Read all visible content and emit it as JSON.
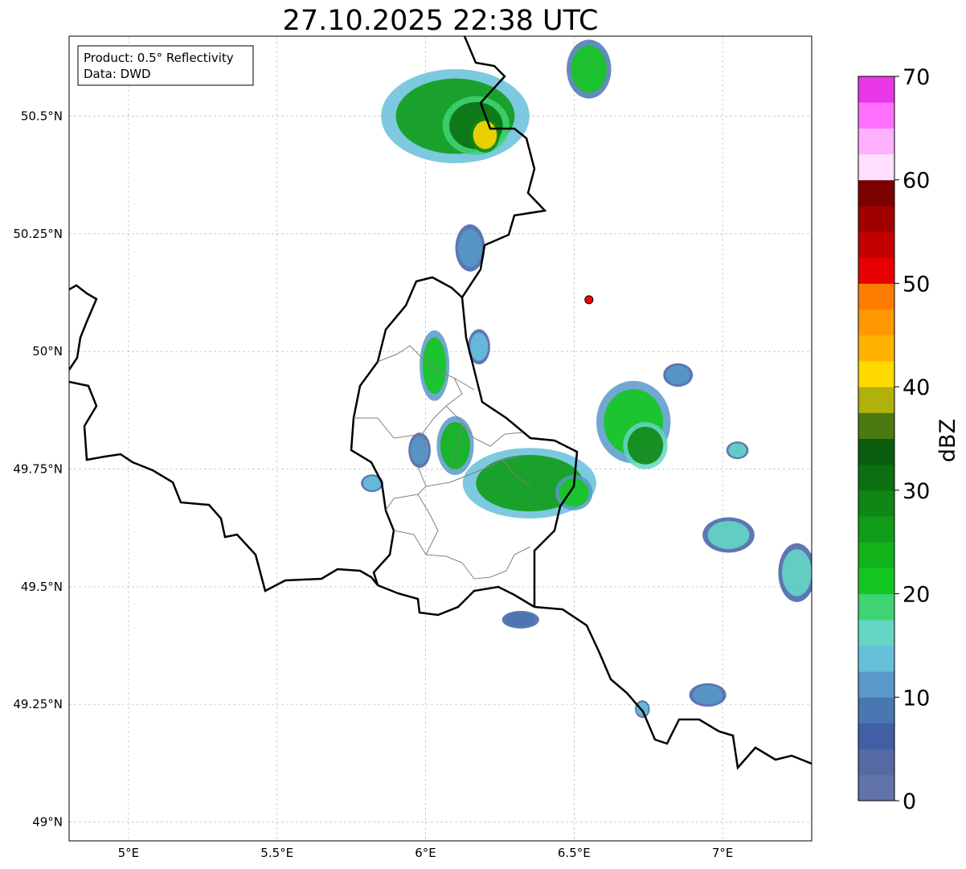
{
  "title": "27.10.2025 22:38 UTC",
  "info_box": {
    "line1": "Product: 0.5° Reflectivity",
    "line2": "Data: DWD"
  },
  "map": {
    "lon_range": [
      4.8,
      7.3
    ],
    "lat_range": [
      48.96,
      50.67
    ],
    "x_ticks": [
      {
        "value": 5.0,
        "label": "5°E"
      },
      {
        "value": 5.5,
        "label": "5.5°E"
      },
      {
        "value": 6.0,
        "label": "6°E"
      },
      {
        "value": 6.5,
        "label": "6.5°E"
      },
      {
        "value": 7.0,
        "label": "7°E"
      }
    ],
    "y_ticks": [
      {
        "value": 49.0,
        "label": "49°N"
      },
      {
        "value": 49.25,
        "label": "49.25°N"
      },
      {
        "value": 49.5,
        "label": "49.5°N"
      },
      {
        "value": 49.75,
        "label": "49.75°N"
      },
      {
        "value": 50.0,
        "label": "50°N"
      },
      {
        "value": 50.25,
        "label": "50.25°N"
      },
      {
        "value": 50.5,
        "label": "50.5°N"
      }
    ],
    "grid": true,
    "radar_site": {
      "lon": 6.55,
      "lat": 50.11,
      "color": "#ff0000"
    },
    "echoes": [
      {
        "lon": 6.1,
        "lat": 50.5,
        "rlon": 0.2,
        "rlat": 0.08,
        "dbz": 25
      },
      {
        "lon": 6.17,
        "lat": 50.48,
        "rlon": 0.09,
        "rlat": 0.05,
        "dbz": 30
      },
      {
        "lon": 6.2,
        "lat": 50.46,
        "rlon": 0.04,
        "rlat": 0.03,
        "dbz": 40
      },
      {
        "lon": 6.55,
        "lat": 50.6,
        "rlon": 0.06,
        "rlat": 0.05,
        "dbz": 20
      },
      {
        "lon": 6.15,
        "lat": 50.22,
        "rlon": 0.04,
        "rlat": 0.04,
        "dbz": 12
      },
      {
        "lon": 6.03,
        "lat": 49.97,
        "rlon": 0.04,
        "rlat": 0.06,
        "dbz": 22
      },
      {
        "lon": 6.18,
        "lat": 50.01,
        "rlon": 0.03,
        "rlat": 0.03,
        "dbz": 14
      },
      {
        "lon": 6.1,
        "lat": 49.8,
        "rlon": 0.05,
        "rlat": 0.05,
        "dbz": 24
      },
      {
        "lon": 5.98,
        "lat": 49.79,
        "rlon": 0.03,
        "rlat": 0.03,
        "dbz": 12
      },
      {
        "lon": 6.35,
        "lat": 49.72,
        "rlon": 0.18,
        "rlat": 0.06,
        "dbz": 25
      },
      {
        "lon": 6.5,
        "lat": 49.7,
        "rlon": 0.05,
        "rlat": 0.03,
        "dbz": 22
      },
      {
        "lon": 6.7,
        "lat": 49.85,
        "rlon": 0.1,
        "rlat": 0.07,
        "dbz": 22
      },
      {
        "lon": 6.74,
        "lat": 49.8,
        "rlon": 0.06,
        "rlat": 0.04,
        "dbz": 28
      },
      {
        "lon": 7.02,
        "lat": 49.61,
        "rlon": 0.07,
        "rlat": 0.03,
        "dbz": 16
      },
      {
        "lon": 7.25,
        "lat": 49.53,
        "rlon": 0.05,
        "rlat": 0.05,
        "dbz": 16
      },
      {
        "lon": 6.95,
        "lat": 49.27,
        "rlon": 0.05,
        "rlat": 0.02,
        "dbz": 10
      },
      {
        "lon": 6.32,
        "lat": 49.43,
        "rlon": 0.05,
        "rlat": 0.015,
        "dbz": 8
      },
      {
        "lon": 5.82,
        "lat": 49.72,
        "rlon": 0.03,
        "rlat": 0.015,
        "dbz": 14
      },
      {
        "lon": 7.05,
        "lat": 49.79,
        "rlon": 0.03,
        "rlat": 0.015,
        "dbz": 16
      },
      {
        "lon": 6.85,
        "lat": 49.95,
        "rlon": 0.04,
        "rlat": 0.02,
        "dbz": 10
      },
      {
        "lon": 6.73,
        "lat": 49.24,
        "rlon": 0.02,
        "rlat": 0.015,
        "dbz": 14
      }
    ]
  },
  "colorbar": {
    "label": "dBZ",
    "min": 0,
    "max": 70,
    "step": 2.5,
    "ticks": [
      {
        "value": 0,
        "label": "0"
      },
      {
        "value": 10,
        "label": "10"
      },
      {
        "value": 20,
        "label": "20"
      },
      {
        "value": 30,
        "label": "30"
      },
      {
        "value": 40,
        "label": "40"
      },
      {
        "value": 50,
        "label": "50"
      },
      {
        "value": 60,
        "label": "60"
      },
      {
        "value": 70,
        "label": "70"
      }
    ],
    "colors": [
      "#6273a9",
      "#556aa3",
      "#425ea4",
      "#4a76b2",
      "#5899c9",
      "#66c0da",
      "#64d6c4",
      "#3fd473",
      "#14c720",
      "#12b31a",
      "#109c18",
      "#0e8714",
      "#0b7012",
      "#0a5c0e",
      "#4a7a10",
      "#b0b10a",
      "#ffd800",
      "#ffb300",
      "#ff9800",
      "#ff7c00",
      "#e60000",
      "#c20000",
      "#a00000",
      "#7c0000",
      "#ffe0ff",
      "#ffb0ff",
      "#ff70ff",
      "#e838e8"
    ]
  }
}
